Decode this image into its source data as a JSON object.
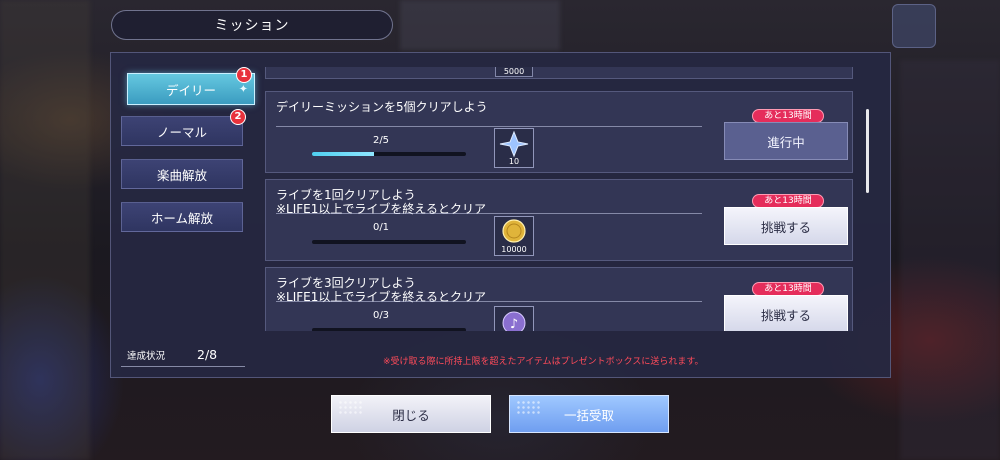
{
  "screen": {
    "title": "ミッション"
  },
  "tabs": [
    {
      "label": "デイリー",
      "badge": "1",
      "active": true
    },
    {
      "label": "ノーマル",
      "badge": "2",
      "active": false
    },
    {
      "label": "楽曲解放",
      "badge": "",
      "active": false
    },
    {
      "label": "ホーム解放",
      "badge": "",
      "active": false
    }
  ],
  "list_top_reward_qty": "5000",
  "missions": [
    {
      "text_lines": [
        "デイリーミッションを5個クリアしよう"
      ],
      "progress_text": "2/5",
      "progress": 0.4,
      "reward_icon": "star-crystal-icon",
      "reward_qty": "10",
      "timer": "あと13時間",
      "action": "進行中",
      "claimable": false
    },
    {
      "text_lines": [
        "ライブを1回クリアしよう",
        "※LIFE1以上でライブを終えるとクリア"
      ],
      "progress_text": "0/1",
      "progress": 0.0,
      "reward_icon": "gold-coin-icon",
      "reward_qty": "10000",
      "timer": "あと13時間",
      "action": "挑戦する",
      "claimable": true
    },
    {
      "text_lines": [
        "ライブを3回クリアしよう",
        "※LIFE1以上でライブを終えるとクリア"
      ],
      "progress_text": "0/3",
      "progress": 0.0,
      "reward_icon": "music-note-icon",
      "reward_qty": "",
      "timer": "あと13時間",
      "action": "挑戦する",
      "claimable": true
    }
  ],
  "summary": {
    "label": "達成状況",
    "value": "2/8"
  },
  "notice": "※受け取る際に所持上限を超えたアイテムはプレゼントボックスに送られます。",
  "buttons": {
    "close": "閉じる",
    "claim_all": "一括受取"
  }
}
